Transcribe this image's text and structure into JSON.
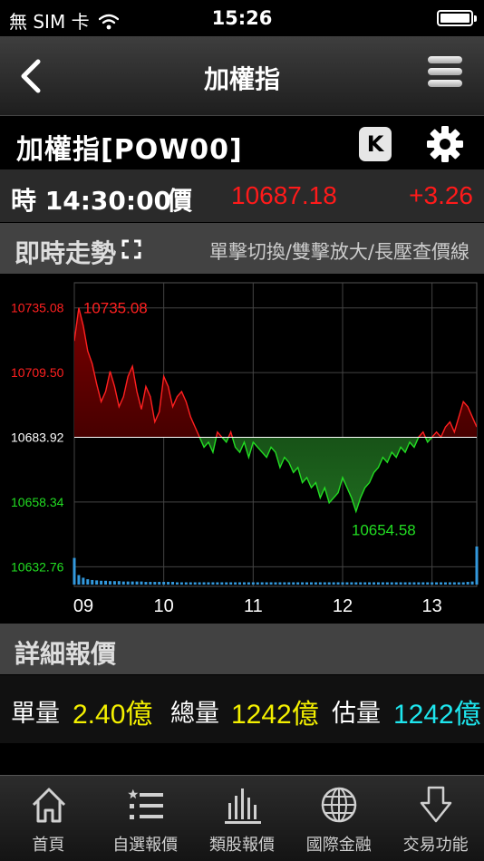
{
  "status_bar": {
    "carrier": "無 SIM 卡",
    "time": "15:26",
    "battery_level": 1.0
  },
  "nav": {
    "title": "加權指",
    "back_icon": "chevron-left-icon",
    "menu_icon": "hamburger-menu-icon"
  },
  "symbol": {
    "name": "加權指[POW00]",
    "k_button": "K",
    "settings_icon": "gear-icon"
  },
  "quote": {
    "time_label": "時 14:30:00",
    "price_label": "價",
    "price": "10687.18",
    "change": "+3.26",
    "up_color": "#ff1a1a"
  },
  "trend_section": {
    "title": "即時走勢",
    "hint": "單擊切換/雙擊放大/長壓查價線"
  },
  "chart_data": {
    "type": "area",
    "reference": 10683.92,
    "ylim": [
      10625,
      10745
    ],
    "xlim": [
      9.0,
      13.5
    ],
    "y_ticks": [
      "10735.08",
      "10709.50",
      "10683.92",
      "10658.34",
      "10632.76"
    ],
    "y_tick_values": [
      10735.08,
      10709.5,
      10683.92,
      10658.34,
      10632.76
    ],
    "x_ticks": [
      "09",
      "10",
      "11",
      "12",
      "13"
    ],
    "x_tick_values": [
      9,
      10,
      11,
      12,
      13
    ],
    "high_label": "10735.08",
    "low_label": "10654.58",
    "colors": {
      "up": "#ff2020",
      "down": "#22dd22",
      "ref": "#ffffff",
      "volume": "#3399dd"
    },
    "x": [
      9.0,
      9.05,
      9.1,
      9.15,
      9.2,
      9.25,
      9.3,
      9.35,
      9.4,
      9.45,
      9.5,
      9.55,
      9.6,
      9.65,
      9.7,
      9.75,
      9.8,
      9.85,
      9.9,
      9.95,
      10.0,
      10.05,
      10.1,
      10.15,
      10.2,
      10.25,
      10.3,
      10.35,
      10.4,
      10.45,
      10.5,
      10.55,
      10.6,
      10.65,
      10.7,
      10.75,
      10.8,
      10.85,
      10.9,
      10.95,
      11.0,
      11.05,
      11.1,
      11.15,
      11.2,
      11.25,
      11.3,
      11.35,
      11.4,
      11.45,
      11.5,
      11.55,
      11.6,
      11.65,
      11.7,
      11.75,
      11.8,
      11.85,
      11.9,
      11.95,
      12.0,
      12.05,
      12.1,
      12.15,
      12.2,
      12.25,
      12.3,
      12.35,
      12.4,
      12.45,
      12.5,
      12.55,
      12.6,
      12.65,
      12.7,
      12.75,
      12.8,
      12.85,
      12.9,
      12.95,
      13.0,
      13.05,
      13.1,
      13.15,
      13.2,
      13.25,
      13.3,
      13.35,
      13.4,
      13.45,
      13.5
    ],
    "y": [
      10722,
      10735.08,
      10728,
      10718,
      10713,
      10705,
      10698,
      10702,
      10710,
      10704,
      10696,
      10700,
      10708,
      10712,
      10702,
      10695,
      10704,
      10700,
      10690,
      10694,
      10708,
      10704,
      10696,
      10700,
      10702,
      10698,
      10692,
      10688,
      10684,
      10680,
      10682,
      10678,
      10686,
      10684,
      10682,
      10686,
      10680,
      10678,
      10682,
      10676,
      10682,
      10680,
      10678,
      10676,
      10680,
      10678,
      10672,
      10676,
      10674,
      10670,
      10672,
      10666,
      10668,
      10664,
      10666,
      10660,
      10664,
      10658,
      10660,
      10662,
      10668,
      10664,
      10660,
      10654.58,
      10660,
      10664,
      10666,
      10670,
      10672,
      10676,
      10674,
      10678,
      10676,
      10680,
      10678,
      10682,
      10680,
      10684,
      10686,
      10682,
      10684,
      10686,
      10684,
      10688,
      10690,
      10686,
      10692,
      10698,
      10696,
      10692,
      10688
    ],
    "volume": [
      0.7,
      0.25,
      0.18,
      0.14,
      0.12,
      0.11,
      0.1,
      0.1,
      0.09,
      0.09,
      0.09,
      0.08,
      0.08,
      0.08,
      0.08,
      0.08,
      0.07,
      0.07,
      0.07,
      0.07,
      0.07,
      0.07,
      0.07,
      0.06,
      0.06,
      0.06,
      0.06,
      0.06,
      0.06,
      0.06,
      0.06,
      0.06,
      0.06,
      0.06,
      0.06,
      0.06,
      0.06,
      0.06,
      0.06,
      0.06,
      0.06,
      0.06,
      0.06,
      0.06,
      0.06,
      0.06,
      0.06,
      0.06,
      0.06,
      0.06,
      0.06,
      0.06,
      0.06,
      0.06,
      0.06,
      0.06,
      0.06,
      0.06,
      0.06,
      0.06,
      0.06,
      0.06,
      0.06,
      0.06,
      0.06,
      0.06,
      0.06,
      0.06,
      0.06,
      0.06,
      0.06,
      0.06,
      0.06,
      0.06,
      0.06,
      0.06,
      0.06,
      0.06,
      0.06,
      0.06,
      0.06,
      0.06,
      0.06,
      0.06,
      0.06,
      0.06,
      0.06,
      0.06,
      0.07,
      0.08,
      1.0
    ]
  },
  "detail_section": {
    "title": "詳細報價"
  },
  "details": [
    {
      "label": "單量",
      "value": "2.40億",
      "color": "yellow"
    },
    {
      "label": "總量",
      "value": "1242億",
      "color": "yellow"
    },
    {
      "label": "估量",
      "value": "1242億",
      "color": "cyan"
    }
  ],
  "tabs": [
    {
      "label": "首頁",
      "icon": "home-icon"
    },
    {
      "label": "自選報價",
      "icon": "list-star-icon"
    },
    {
      "label": "類股報價",
      "icon": "bar-chart-icon"
    },
    {
      "label": "國際金融",
      "icon": "globe-icon"
    },
    {
      "label": "交易功能",
      "icon": "arrow-down-icon"
    }
  ]
}
